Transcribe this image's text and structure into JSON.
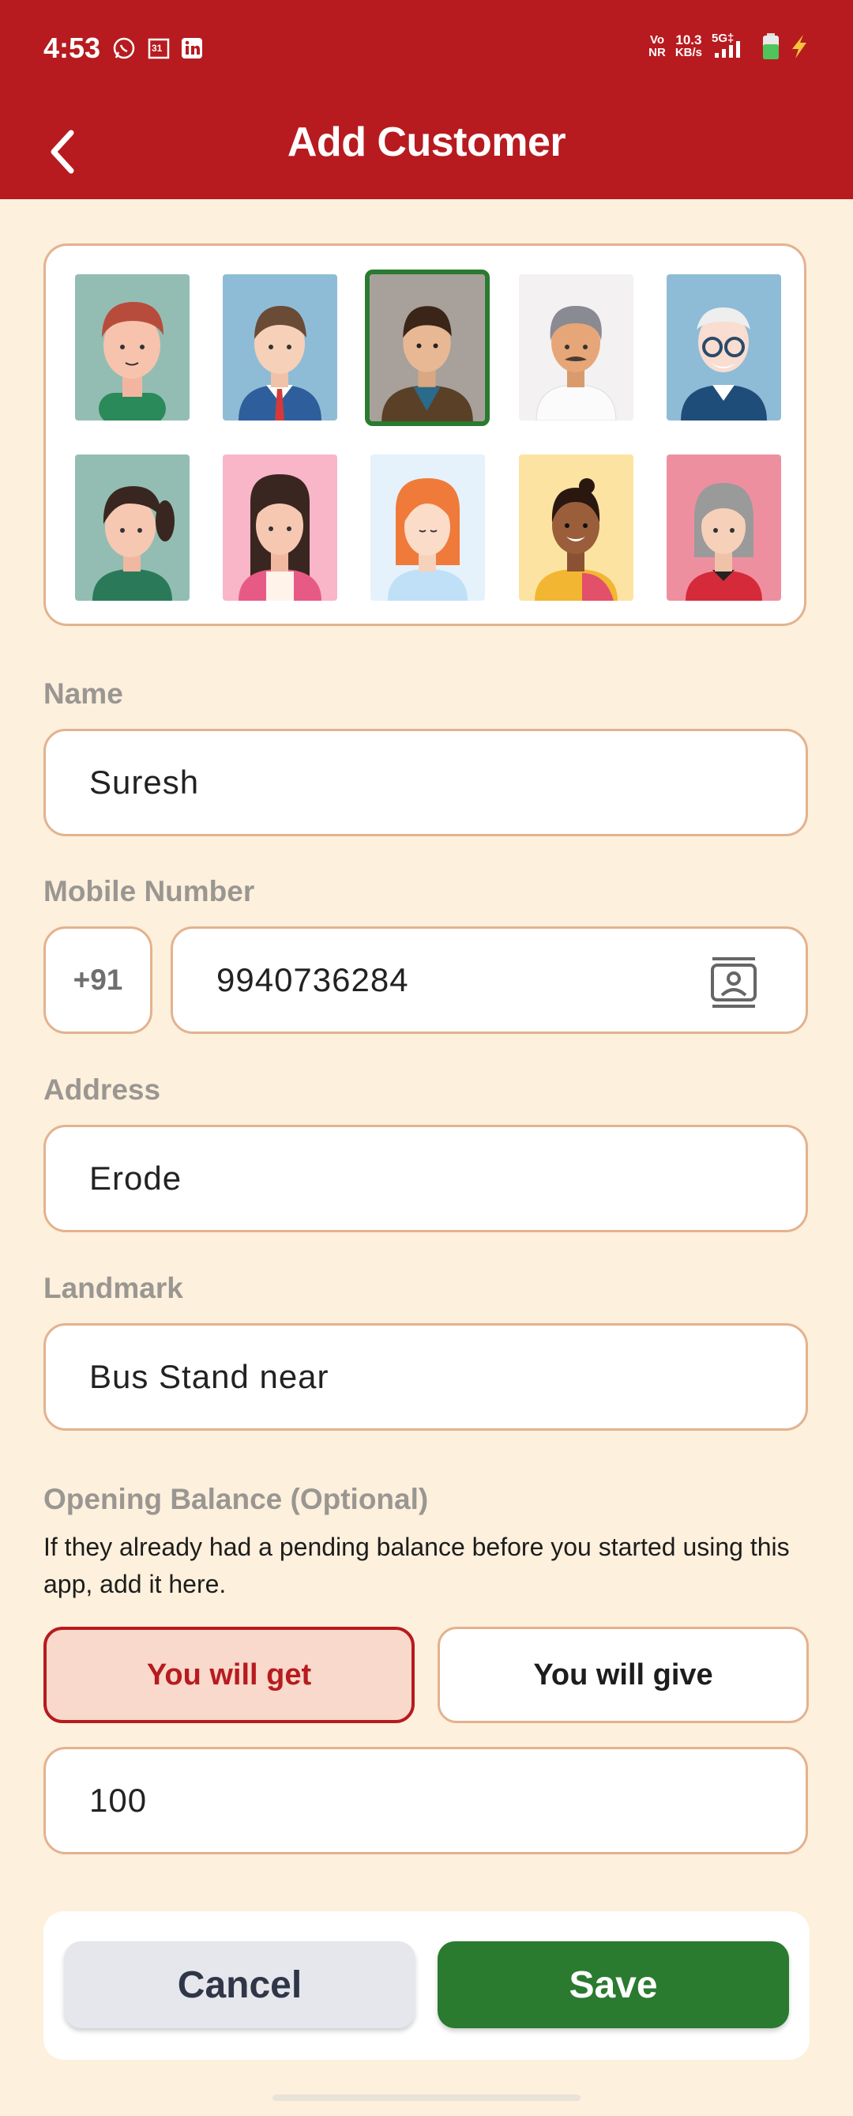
{
  "status_bar": {
    "time": "4:53",
    "icons": [
      "whatsapp-icon",
      "calendar-icon",
      "linkedin-icon"
    ],
    "calendar_day": "31",
    "network_top": "Vo",
    "network_bottom": "NR",
    "speed_value": "10.3",
    "speed_unit": "KB/s",
    "signal_label": "5G‡"
  },
  "app_bar": {
    "title": "Add Customer",
    "back_icon": "chevron-left-icon"
  },
  "avatars": {
    "selected_index": 2,
    "items": [
      "avatar-young-man-red-hair",
      "avatar-man-suit-red-tie",
      "avatar-man-brown-jacket",
      "avatar-elderly-man-mustache",
      "avatar-elderly-man-glasses",
      "avatar-girl-ponytail",
      "avatar-woman-long-hair",
      "avatar-woman-red-hair",
      "avatar-woman-saree",
      "avatar-elderly-woman"
    ]
  },
  "form": {
    "name_label": "Name",
    "name_value": "Suresh",
    "mobile_label": "Mobile Number",
    "country_code": "+91",
    "mobile_value": "9940736284",
    "address_label": "Address",
    "address_value": "Erode",
    "landmark_label": "Landmark",
    "landmark_value": "Bus Stand near",
    "opening_balance_label": "Opening Balance (Optional)",
    "opening_balance_desc": "If they already had a pending balance before you started using this app, add it here.",
    "you_will_get": "You will get",
    "you_will_give": "You will give",
    "selected_direction": "You will get",
    "amount_value": "100"
  },
  "actions": {
    "cancel": "Cancel",
    "save": "Save"
  },
  "colors": {
    "primary_red": "#b71b1f",
    "background": "#fdf0dc",
    "field_border": "#e3b28f",
    "save_green": "#2a7a2f",
    "cancel_gray": "#e6e7ec"
  }
}
